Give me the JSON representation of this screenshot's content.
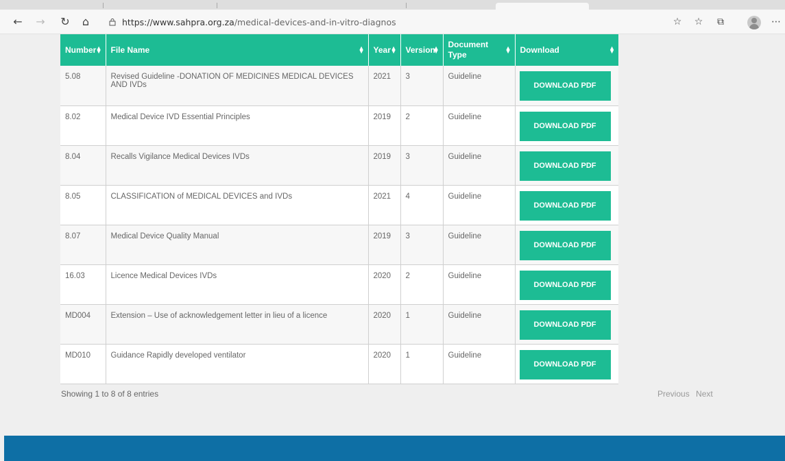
{
  "browser": {
    "url_host": "https://www.sahpra.org.za",
    "url_path": "/medical-devices-and-in-vitro-diagnostics-guidelines/",
    "icons": [
      "back-arrow-icon",
      "forward-arrow-icon",
      "refresh-icon",
      "home-icon",
      "lock-icon",
      "favorite-add-icon",
      "favorites-icon",
      "collections-icon",
      "profile-avatar-icon",
      "more-icon"
    ]
  },
  "table": {
    "headers": [
      "Number",
      "File Name",
      "Year",
      "Version",
      "Document Type",
      "Download"
    ],
    "rows": [
      {
        "number": "5.08",
        "file_name": "Revised Guideline -DONATION OF MEDICINES MEDICAL DEVICES AND IVDs",
        "year": "2021",
        "version": "3",
        "doc_type": "Guideline",
        "download": "DOWNLOAD PDF"
      },
      {
        "number": "8.02",
        "file_name": "Medical Device IVD Essential Principles",
        "year": "2019",
        "version": "2",
        "doc_type": "Guideline",
        "download": "DOWNLOAD PDF"
      },
      {
        "number": "8.04",
        "file_name": "Recalls Vigilance Medical Devices IVDs",
        "year": "2019",
        "version": "3",
        "doc_type": "Guideline",
        "download": "DOWNLOAD PDF"
      },
      {
        "number": "8.05",
        "file_name": "CLASSIFICATION of MEDICAL DEVICES and IVDs",
        "year": "2021",
        "version": "4",
        "doc_type": "Guideline",
        "download": "DOWNLOAD PDF"
      },
      {
        "number": "8.07",
        "file_name": "Medical Device Quality Manual",
        "year": "2019",
        "version": "3",
        "doc_type": "Guideline",
        "download": "DOWNLOAD PDF"
      },
      {
        "number": "16.03",
        "file_name": "Licence Medical Devices IVDs",
        "year": "2020",
        "version": "2",
        "doc_type": "Guideline",
        "download": "DOWNLOAD PDF"
      },
      {
        "number": "MD004",
        "file_name": "Extension – Use of acknowledgement letter in lieu of a licence",
        "year": "2020",
        "version": "1",
        "doc_type": "Guideline",
        "download": "DOWNLOAD PDF"
      },
      {
        "number": "MD010",
        "file_name": "Guidance Rapidly developed ventilator",
        "year": "2020",
        "version": "1",
        "doc_type": "Guideline",
        "download": "DOWNLOAD PDF"
      }
    ]
  },
  "info": "Showing 1 to 8 of 8 entries",
  "pagination": {
    "previous": "Previous",
    "next": "Next"
  },
  "colors": {
    "accent": "#1dbc94",
    "footer": "#0e6fa5"
  }
}
